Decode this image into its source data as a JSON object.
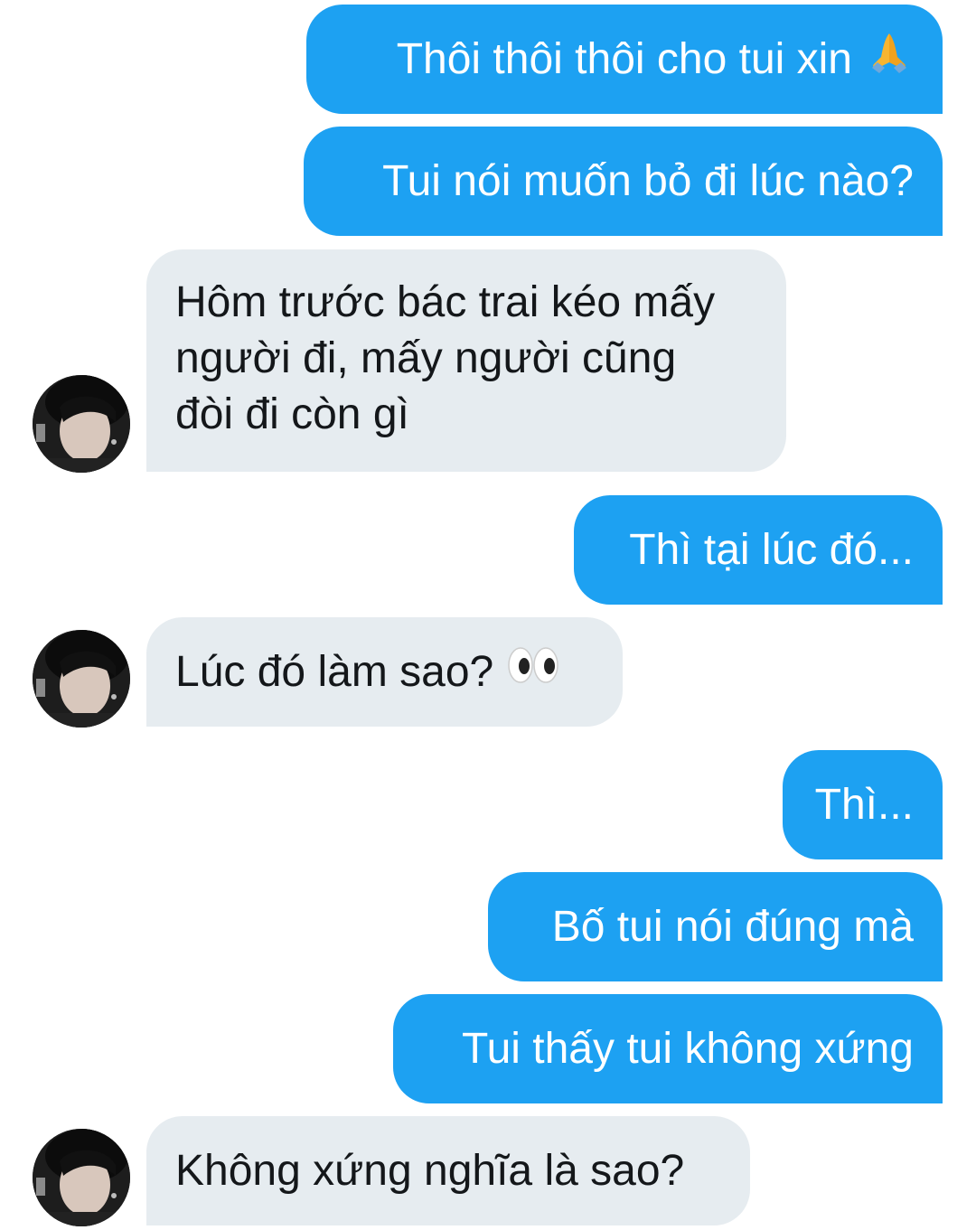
{
  "messages": [
    {
      "side": "sent",
      "text": "Thôi thôi thôi cho tui xin",
      "emoji": "folded-hands-icon"
    },
    {
      "side": "sent",
      "text": "Tui nói muốn bỏ đi lúc nào?"
    },
    {
      "side": "received",
      "text": "Hôm trước bác trai kéo mấy người đi, mấy người cũng đòi đi còn gì"
    },
    {
      "side": "sent",
      "text": "Thì tại lúc đó..."
    },
    {
      "side": "received",
      "text": "Lúc đó làm sao?",
      "emoji": "eyes-icon"
    },
    {
      "side": "sent",
      "text": "Thì..."
    },
    {
      "side": "sent",
      "text": "Bố tui nói đúng mà"
    },
    {
      "side": "sent",
      "text": "Tui thấy tui không xứng"
    },
    {
      "side": "received",
      "text": "Không xứng nghĩa là sao?"
    }
  ],
  "colors": {
    "sent_bubble": "#1da1f2",
    "received_bubble": "#e6ecf0",
    "sent_text": "#ffffff",
    "received_text": "#14171a"
  }
}
